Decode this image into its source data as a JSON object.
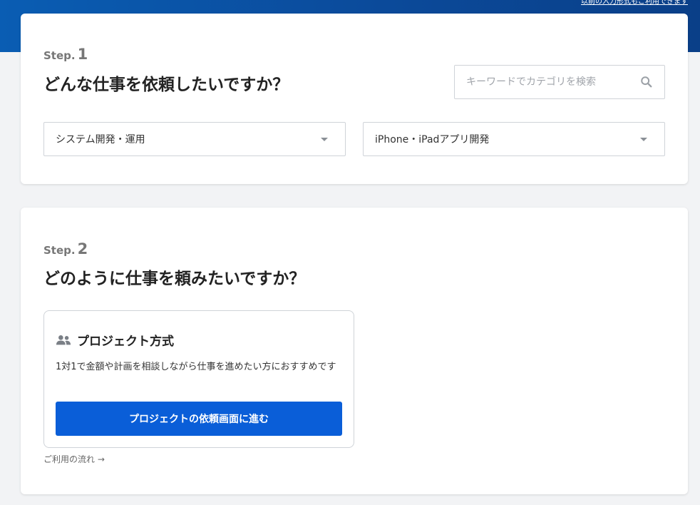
{
  "header": {
    "top_link": "以前の入力形式もご利用できます"
  },
  "step1": {
    "step_word": "Step.",
    "step_num": "1",
    "title": "どんな仕事を依頼したいですか？",
    "search": {
      "placeholder": "キーワードでカテゴリを検索",
      "value": ""
    },
    "category_select": {
      "selected": "システム開発・運用"
    },
    "subcategory_select": {
      "selected": "iPhone・iPadアプリ開発"
    }
  },
  "step2": {
    "step_word": "Step.",
    "step_num": "2",
    "title": "どのように仕事を頼みたいですか？",
    "method": {
      "title": "プロジェクト方式",
      "description": "1対1で金額や計画を相談しながら仕事を進めたい方におすすめです",
      "button_label": "プロジェクトの依頼画面に進む"
    },
    "flow_link": "ご利用の流れ →"
  },
  "colors": {
    "accent": "#0a5ed8",
    "header_band": "#0b4a9a"
  },
  "icons": {
    "search": "search-icon",
    "people": "people-icon",
    "caret": "chevron-down-icon"
  }
}
